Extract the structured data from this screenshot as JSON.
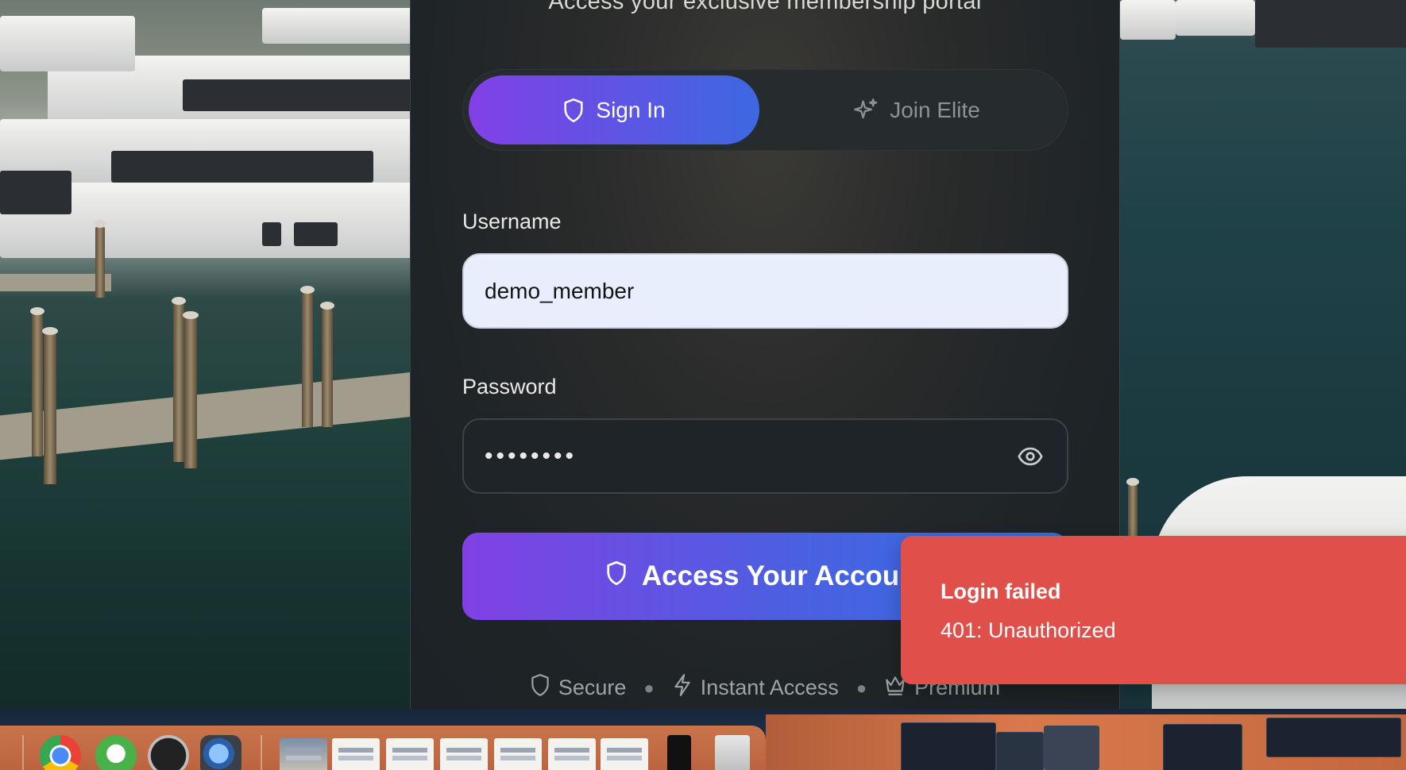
{
  "portal": {
    "subtitle": "Access your exclusive membership portal"
  },
  "tabs": [
    {
      "label": "Sign In",
      "icon": "shield-icon",
      "active": true
    },
    {
      "label": "Join Elite",
      "icon": "sparkles-icon",
      "active": false
    }
  ],
  "form": {
    "username_label": "Username",
    "username_value": "demo_member",
    "password_label": "Password",
    "password_value": "••••••••",
    "submit_label": "Access Your Account"
  },
  "features": [
    {
      "label": "Secure",
      "icon": "shield-icon"
    },
    {
      "label": "Instant Access",
      "icon": "lightning-icon"
    },
    {
      "label": "Premium",
      "icon": "crown-icon"
    }
  ],
  "toast": {
    "title": "Login failed",
    "message": "401: Unauthorized"
  },
  "colors": {
    "accent_start": "#8240e6",
    "accent_end": "#3d68e2",
    "error": "#e04f4a"
  }
}
